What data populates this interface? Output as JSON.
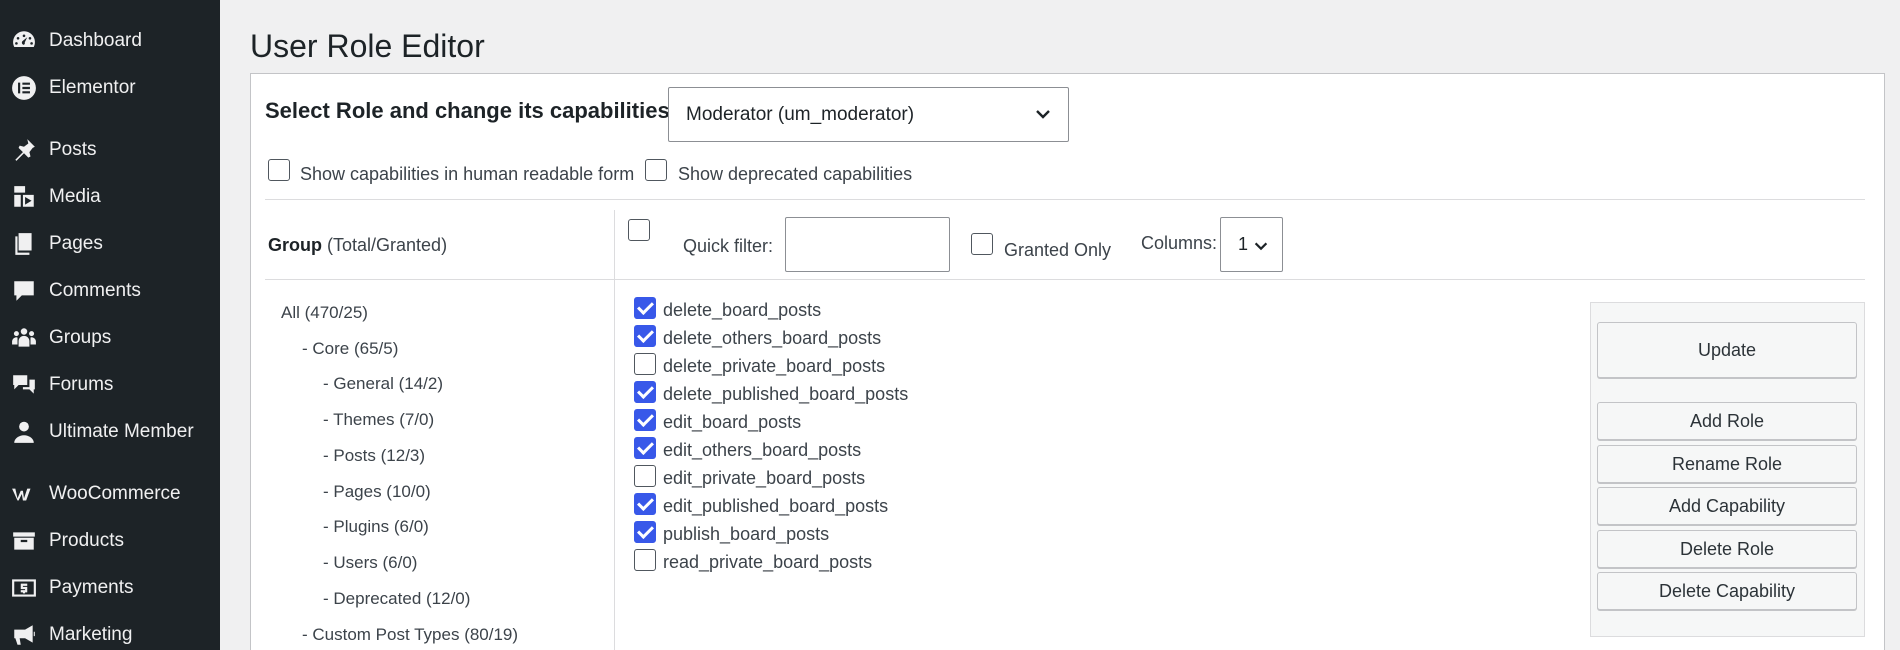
{
  "sidebar": {
    "items": [
      {
        "label": "Dashboard",
        "icon": "dashboard-icon"
      },
      {
        "label": "Elementor",
        "icon": "elementor-icon"
      },
      {
        "label": "Posts",
        "icon": "pin-icon"
      },
      {
        "label": "Media",
        "icon": "media-icon"
      },
      {
        "label": "Pages",
        "icon": "pages-icon"
      },
      {
        "label": "Comments",
        "icon": "comment-icon"
      },
      {
        "label": "Groups",
        "icon": "groups-icon"
      },
      {
        "label": "Forums",
        "icon": "forums-icon"
      },
      {
        "label": "Ultimate Member",
        "icon": "user-icon"
      },
      {
        "label": "WooCommerce",
        "icon": "woocommerce-icon"
      },
      {
        "label": "Products",
        "icon": "archive-icon"
      },
      {
        "label": "Payments",
        "icon": "payments-icon"
      },
      {
        "label": "Marketing",
        "icon": "megaphone-icon"
      }
    ]
  },
  "page": {
    "title": "User Role Editor"
  },
  "role_select": {
    "label": "Select Role and change its capabilities:",
    "value": "Moderator (um_moderator)"
  },
  "options": {
    "human_readable": "Show capabilities in human readable form",
    "deprecated": "Show deprecated capabilities"
  },
  "group_header": {
    "title": "Group",
    "suffix": "(Total/Granted)"
  },
  "filters": {
    "quick_filter_label": "Quick filter:",
    "quick_filter_value": "",
    "granted_only_label": "Granted Only",
    "columns_label": "Columns:",
    "columns_value": "1"
  },
  "groups": [
    "All (470/25)",
    "- Core (65/5)",
    "- General (14/2)",
    "- Themes (7/0)",
    "- Posts (12/3)",
    "- Pages (10/0)",
    "- Plugins (6/0)",
    "- Users (6/0)",
    "- Deprecated (12/0)",
    "- Custom Post Types (80/19)"
  ],
  "capabilities": [
    {
      "name": "delete_board_posts",
      "checked": true
    },
    {
      "name": "delete_others_board_posts",
      "checked": true
    },
    {
      "name": "delete_private_board_posts",
      "checked": false
    },
    {
      "name": "delete_published_board_posts",
      "checked": true
    },
    {
      "name": "edit_board_posts",
      "checked": true
    },
    {
      "name": "edit_others_board_posts",
      "checked": true
    },
    {
      "name": "edit_private_board_posts",
      "checked": false
    },
    {
      "name": "edit_published_board_posts",
      "checked": true
    },
    {
      "name": "publish_board_posts",
      "checked": true
    },
    {
      "name": "read_private_board_posts",
      "checked": false
    }
  ],
  "actions": {
    "update": "Update",
    "add_role": "Add Role",
    "rename_role": "Rename Role",
    "add_capability": "Add Capability",
    "delete_role": "Delete Role",
    "delete_capability": "Delete Capability"
  },
  "colors": {
    "sidebar_bg": "#1d2327",
    "checkbox_checked": "#3858e9"
  }
}
